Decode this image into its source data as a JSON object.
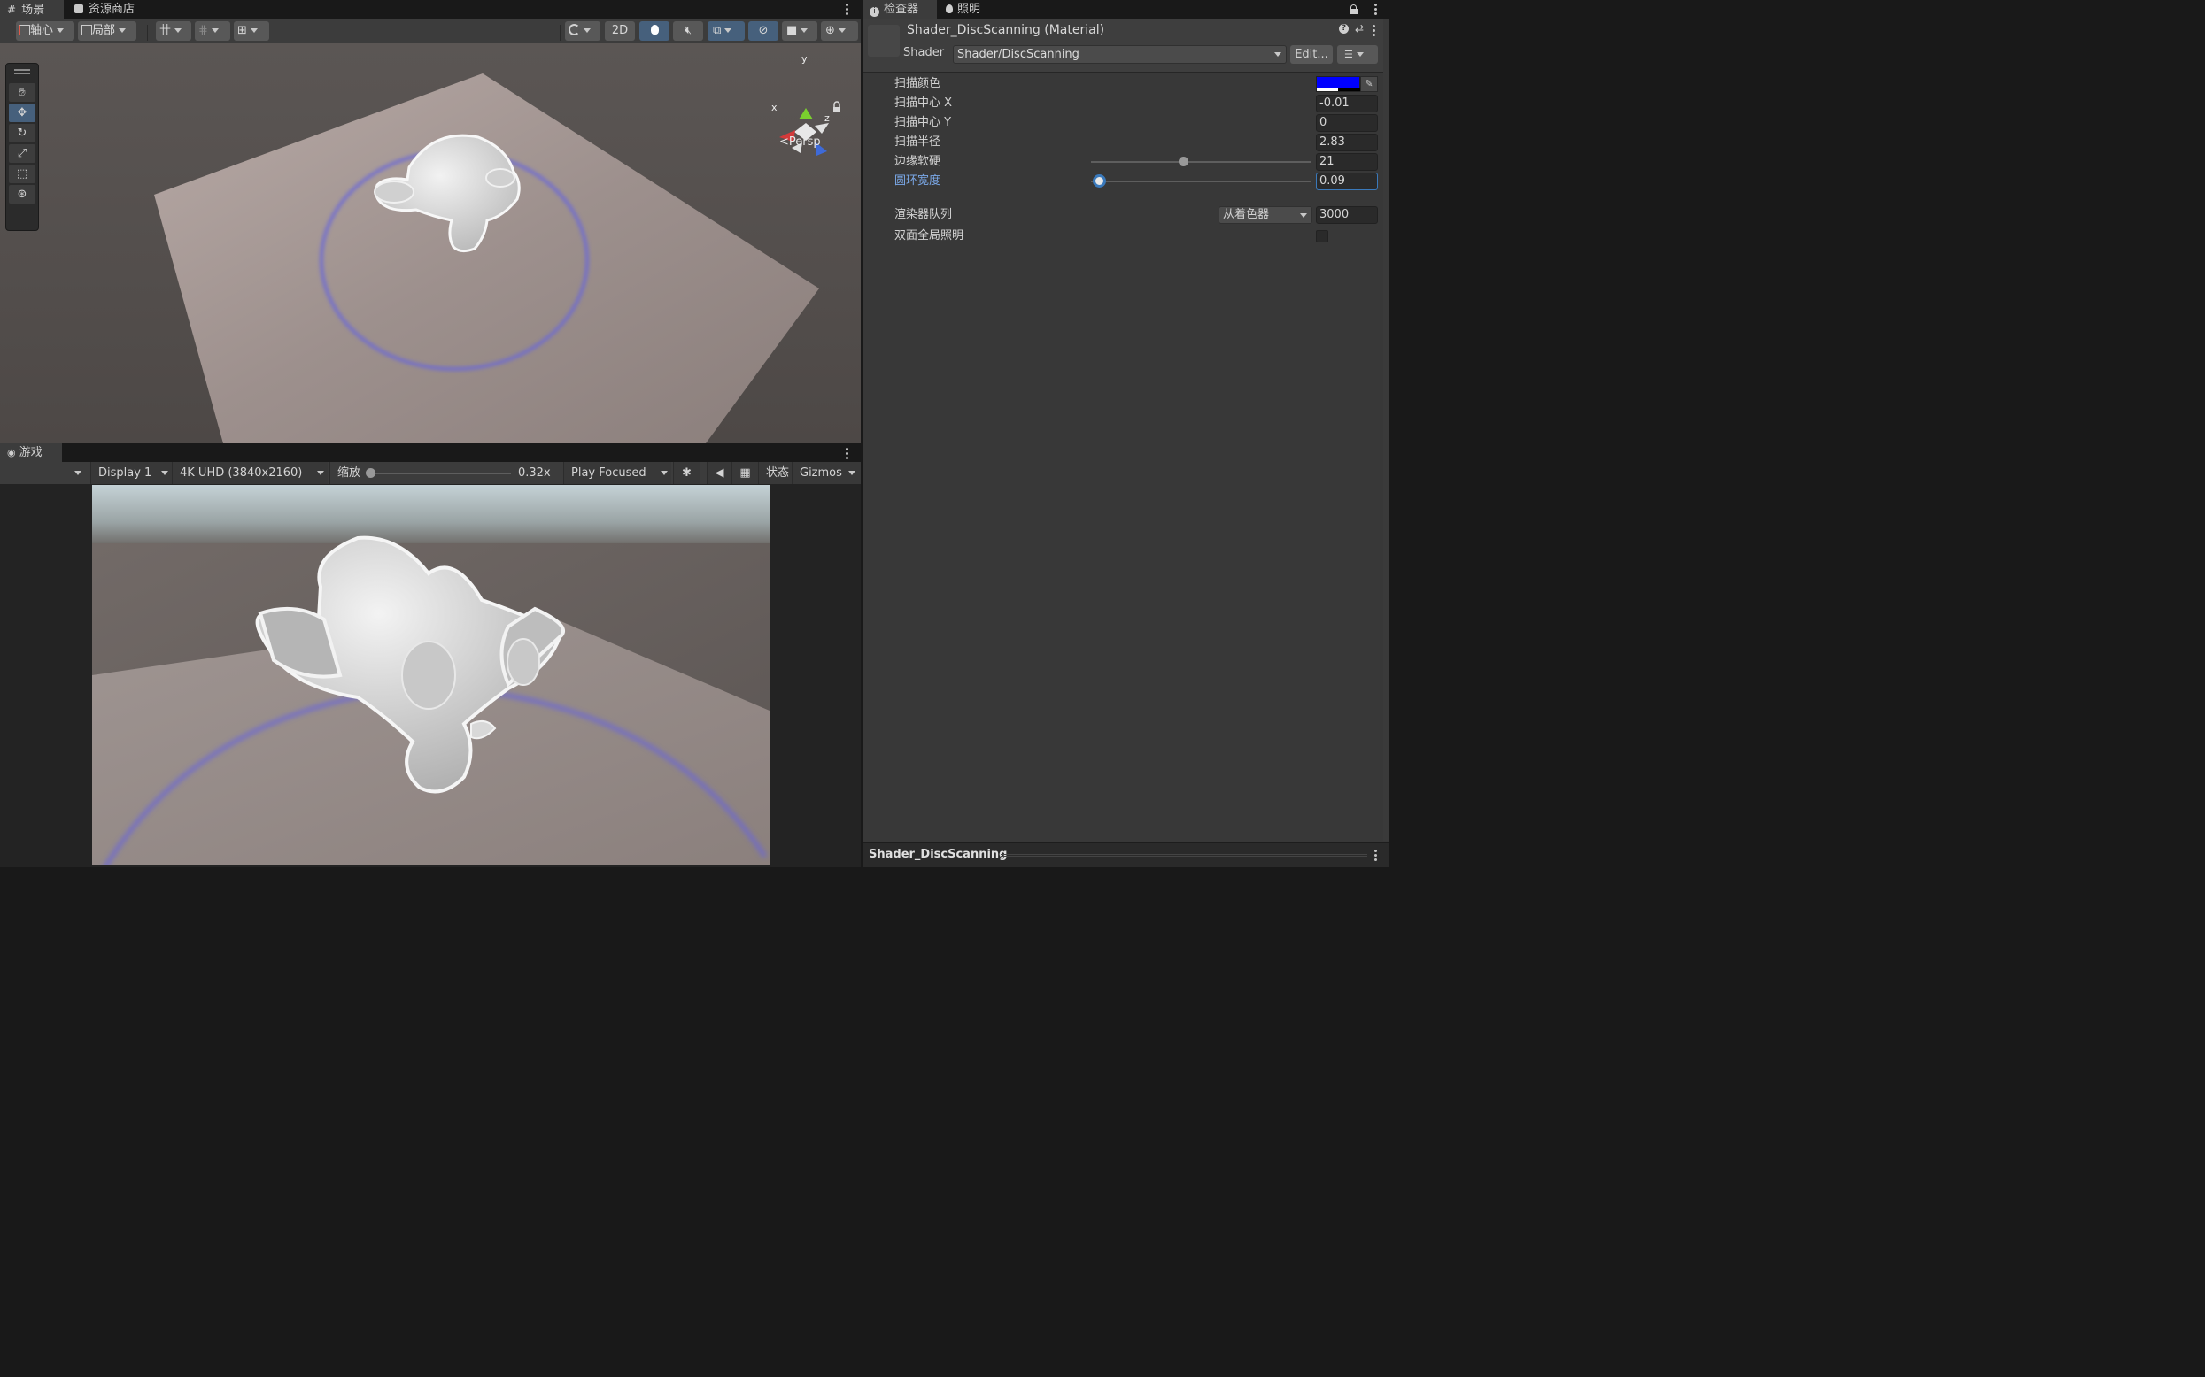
{
  "scene_panel": {
    "tabs": [
      {
        "label": "场景",
        "icon": "grid-icon"
      },
      {
        "label": "资源商店",
        "icon": "store-bag-icon"
      }
    ],
    "pivot_label": "轴心",
    "local_label": "局部",
    "mode_2d": "2D",
    "persp_label": "<Persp",
    "gizmo_axes": {
      "x": "x",
      "y": "y",
      "z": "z"
    }
  },
  "game_panel": {
    "tab_label": "游戏",
    "display": "Display 1",
    "resolution": "4K UHD (3840x2160)",
    "scale_label": "缩放",
    "scale_value": "0.32x",
    "scale_fraction": 0.0,
    "play_mode": "Play Focused",
    "stats_label": "状态",
    "gizmos_label": "Gizmos"
  },
  "inspector": {
    "tabs": [
      {
        "label": "检查器",
        "icon": "info-icon"
      },
      {
        "label": "照明",
        "icon": "lightbulb-icon"
      }
    ],
    "material_title": "Shader_DiscScanning (Material)",
    "shader_label": "Shader",
    "shader_value": "Shader/DiscScanning",
    "edit_button": "Edit...",
    "properties": {
      "scan_color_label": "扫描颜色",
      "scan_color": "#0000ff",
      "center_x_label": "扫描中心 X",
      "center_x": "-0.01",
      "center_y_label": "扫描中心 Y",
      "center_y": "0",
      "radius_label": "扫描半径",
      "radius": "2.83",
      "softness_label": "边缘软硬",
      "softness": "21",
      "softness_fraction": 0.42,
      "ring_width_label": "圆环宽度",
      "ring_width": "0.09",
      "ring_width_fraction": 0.03,
      "render_queue_label": "渲染器队列",
      "render_queue_mode": "从着色器",
      "render_queue_value": "3000",
      "double_sided_gi_label": "双面全局照明",
      "double_sided_gi": false
    },
    "footer_title": "Shader_DiscScanning"
  },
  "colors": {
    "accent_blue": "#46607c",
    "focus_blue": "#3a79bb",
    "highlight_label": "#7aa7e6",
    "scan_ring": "#6b68d8"
  }
}
